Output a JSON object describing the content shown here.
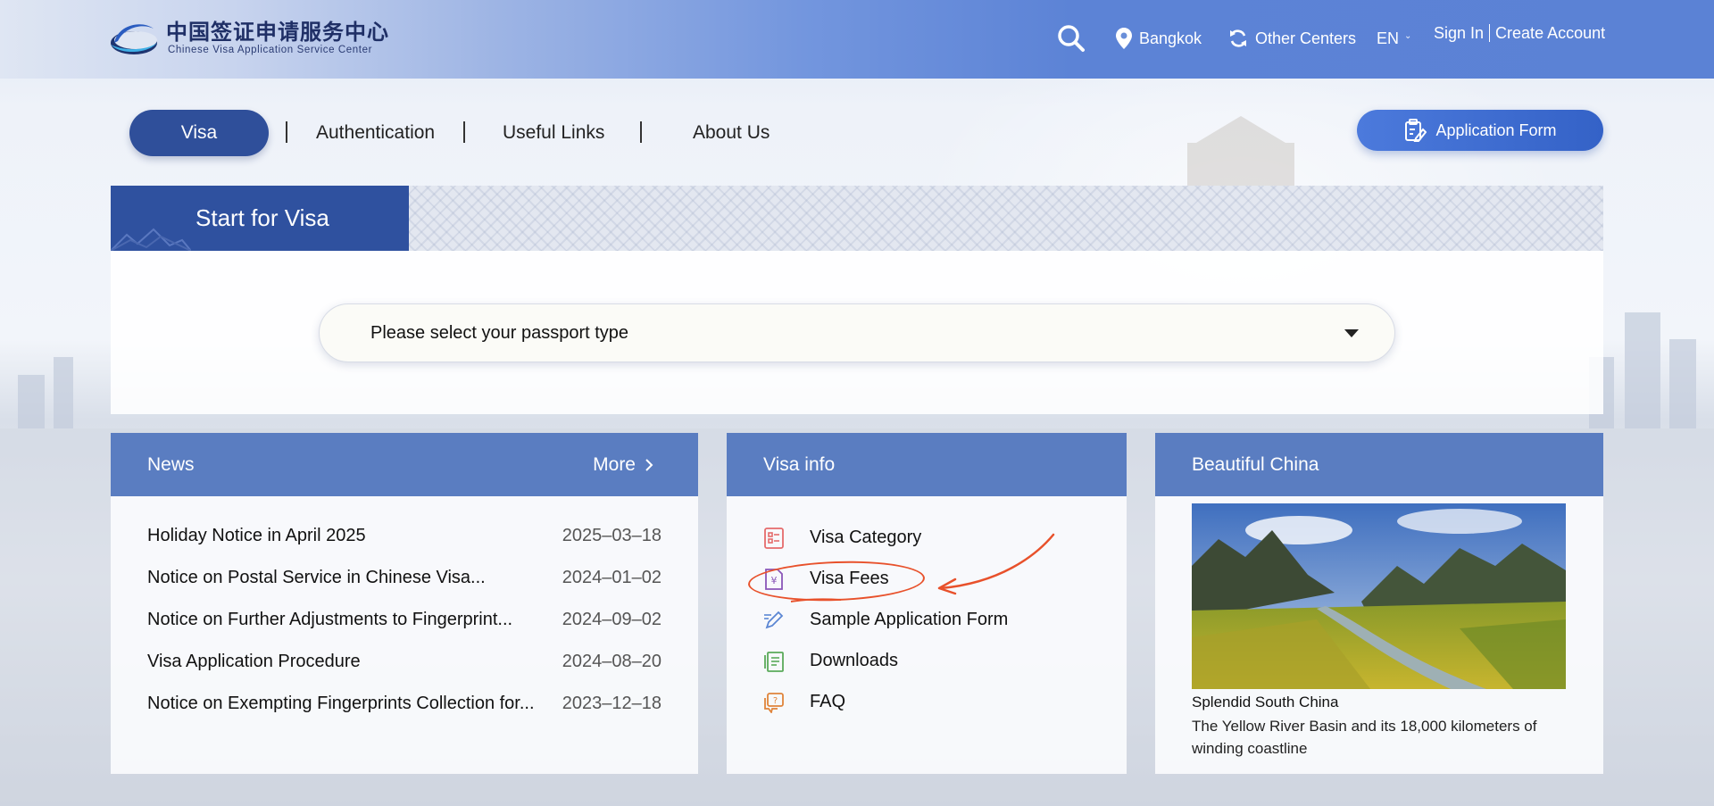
{
  "header": {
    "logo_cn": "中国签证申请服务中心",
    "logo_en": "Chinese Visa Application Service Center",
    "search_icon": "search-icon",
    "location": "Bangkok",
    "other_centers": "Other Centers",
    "language": "EN",
    "sign_in": "Sign In",
    "create_account": "Create Account"
  },
  "nav": {
    "items": [
      "Visa",
      "Authentication",
      "Useful Links",
      "About Us"
    ],
    "active": "Visa",
    "application_form": "Application Form"
  },
  "start": {
    "title": "Start for Visa",
    "passport_placeholder": "Please select your passport type"
  },
  "news": {
    "title": "News",
    "more": "More",
    "items": [
      {
        "title": "Holiday Notice in April 2025",
        "date": "2025–03–18"
      },
      {
        "title": "Notice on Postal Service in Chinese Visa...",
        "date": "2024–01–02"
      },
      {
        "title": "Notice on Further Adjustments to Fingerprint...",
        "date": "2024–09–02"
      },
      {
        "title": "Visa Application Procedure",
        "date": "2024–08–20"
      },
      {
        "title": "Notice on Exempting Fingerprints Collection for...",
        "date": "2023–12–18"
      }
    ]
  },
  "visa_info": {
    "title": "Visa info",
    "items": [
      {
        "label": "Visa Category",
        "icon": "list-icon",
        "color": "#e56b6b"
      },
      {
        "label": "Visa Fees",
        "icon": "yuan-document-icon",
        "color": "#8a56b8"
      },
      {
        "label": "Sample Application Form",
        "icon": "pen-icon",
        "color": "#5b86d3"
      },
      {
        "label": "Downloads",
        "icon": "document-icon",
        "color": "#5aaa5a"
      },
      {
        "label": "FAQ",
        "icon": "question-bubble-icon",
        "color": "#e0843a"
      }
    ],
    "highlighted": "Visa Fees",
    "annotation_color": "#e8512b"
  },
  "beautiful_china": {
    "title": "Beautiful China",
    "caption_title": "Splendid South China",
    "caption_desc": "The Yellow River Basin and its 18,000 kilometers of winding coastline"
  },
  "colors": {
    "header_blue": "#5b82d5",
    "nav_active": "#2f4f9a",
    "card_head": "#5a7dc1",
    "start_tab": "#2f519f"
  }
}
